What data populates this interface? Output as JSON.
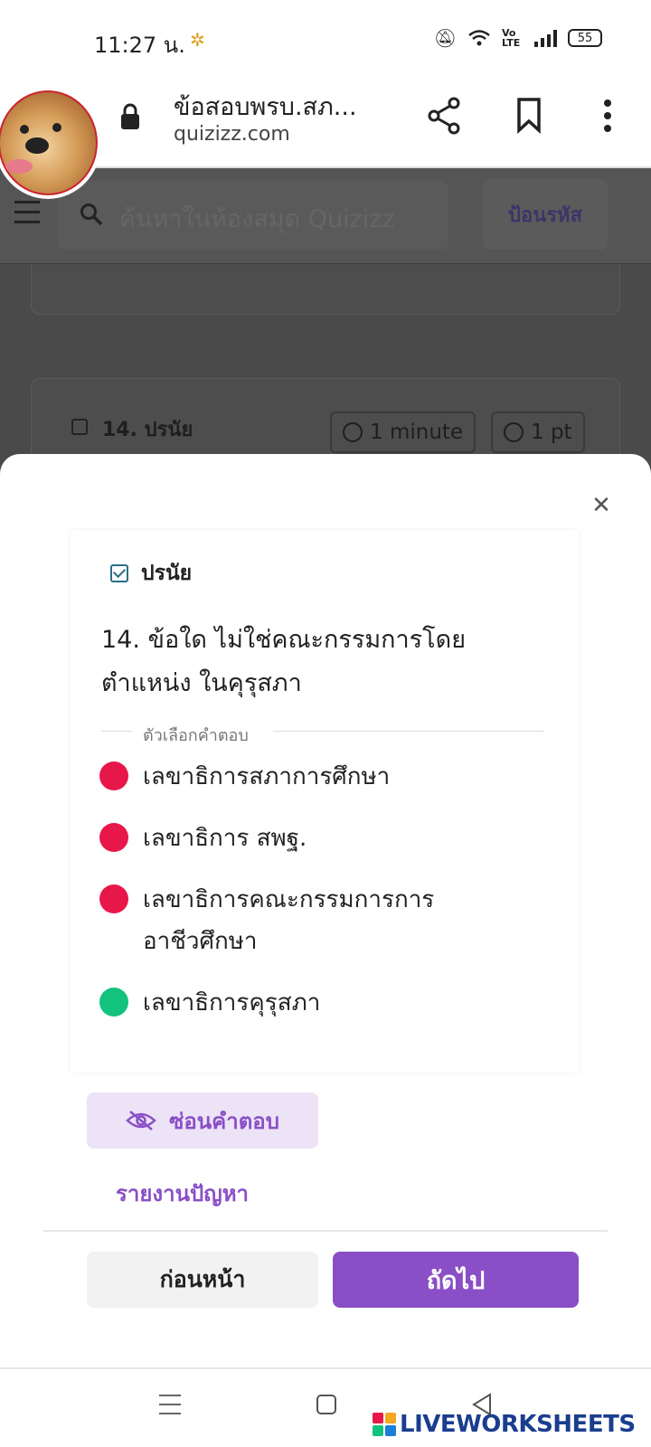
{
  "status_bar": {
    "time": "11:27 น.",
    "battery": "55",
    "network": "Vo LTE"
  },
  "browser": {
    "title": "ข้อสอบพรบ.สภ...",
    "url": "quizizz.com"
  },
  "background_page": {
    "search_placeholder": "ค้นหาในห้องสมุด Quizizz",
    "enter_code": "ป้อนรหัส",
    "question_label": "14. ปรนัย",
    "time_chip": "1 minute",
    "points_chip": "1 pt"
  },
  "sheet": {
    "question_type": "ปรนัย",
    "question_text": "14. ข้อใด ไม่ใช่คณะกรรมการโดยตำแหน่ง ในคุรุสภา",
    "options_label": "ตัวเลือกคำตอบ",
    "options": [
      {
        "text": "เลขาธิการสภาการศึกษา",
        "correct": false
      },
      {
        "text": "เลขาธิการ สพฐ.",
        "correct": false
      },
      {
        "text": "เลขาธิการคณะกรรมการการ อาชีวศึกษา",
        "correct": false
      },
      {
        "text": "เลขาธิการคุรุสภา",
        "correct": true
      }
    ],
    "hide_answer": "ซ่อนคำตอบ",
    "report": "รายงานปัญหา",
    "prev": "ก่อนหน้า",
    "next": "ถัดไป"
  },
  "watermark": "LIVEWORKSHEETS",
  "colors": {
    "wrong": "#e8174a",
    "correct": "#12c27d",
    "accent": "#8a4fc7"
  }
}
